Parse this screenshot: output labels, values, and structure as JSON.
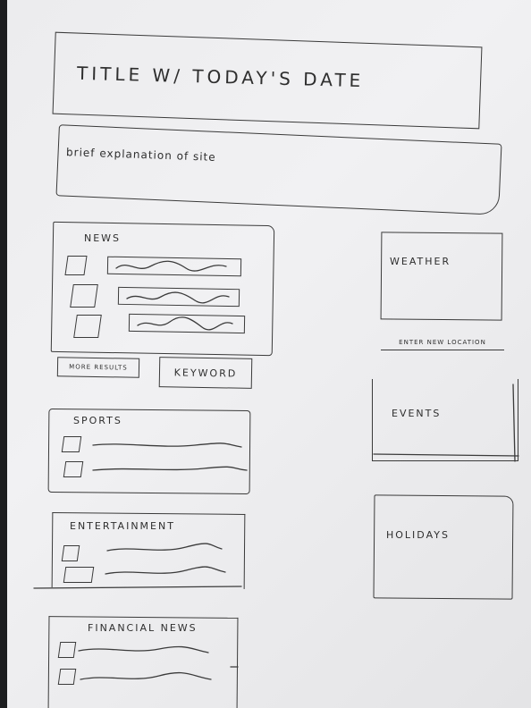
{
  "header": {
    "title": "TITLE W/ TODAY'S DATE",
    "explanation": "brief explanation of site"
  },
  "news": {
    "heading": "NEWS",
    "more_results": "MORE RESULTS",
    "keyword": "KEYWORD"
  },
  "sports": {
    "heading": "SPORTS"
  },
  "entertainment": {
    "heading": "ENTERTAINMENT"
  },
  "financial": {
    "heading": "FINANCIAL NEWS"
  },
  "weather": {
    "heading": "WEATHER",
    "enter_location": "ENTER NEW LOCATION"
  },
  "events": {
    "heading": "EVENTS"
  },
  "holidays": {
    "heading": "HOLIDAYS"
  }
}
